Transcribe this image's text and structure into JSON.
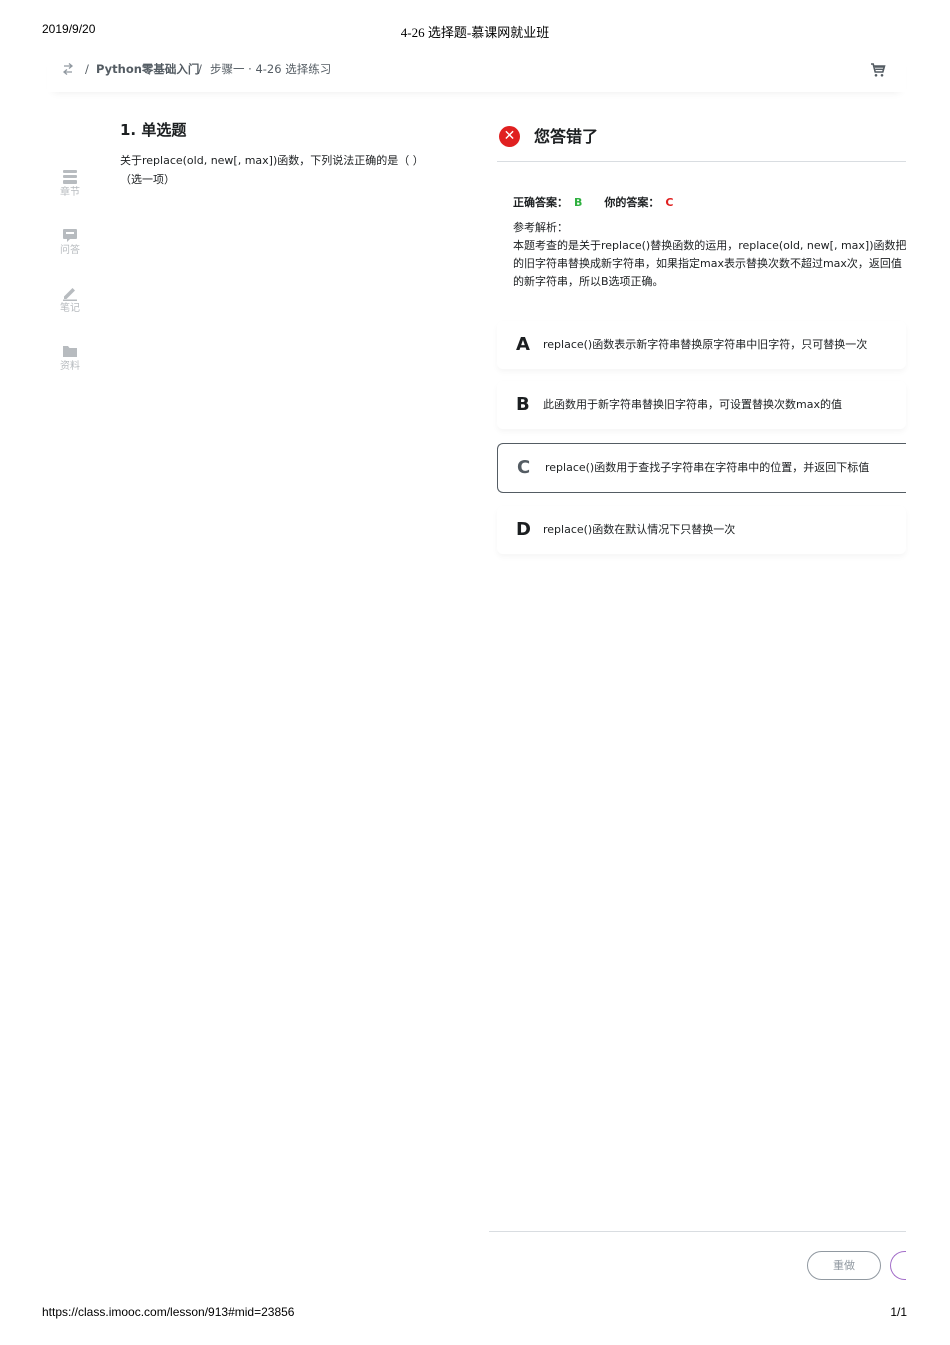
{
  "print_header": {
    "date": "2019/9/20",
    "title": "4-26 选择题-慕课网就业班"
  },
  "print_footer": {
    "url": "https://class.imooc.com/lesson/913#mid=23856",
    "pages": "1/1"
  },
  "breadcrumb": {
    "separator": "/",
    "course": "Python零基础入门",
    "current": "步骤一 · 4-26 选择练习"
  },
  "sidenav": [
    {
      "label": "章节",
      "icon": "chapter-icon"
    },
    {
      "label": "问答",
      "icon": "qa-icon"
    },
    {
      "label": "笔记",
      "icon": "note-pencil-icon"
    },
    {
      "label": "资料",
      "icon": "folder-icon"
    }
  ],
  "question": {
    "title": "1. 单选题",
    "text_line1": "关于replace(old, new[, max])函数，下列说法正确的是（ ）",
    "text_line2": "（选一项）"
  },
  "result": {
    "title": "您答错了",
    "correct_label": "正确答案：",
    "correct_value": "B",
    "your_label": "你的答案：",
    "your_value": "C",
    "analysis_label": "参考解析：",
    "analysis_line1": "本题考查的是关于replace()替换函数的运用，replace(old, new[, max])函数把字",
    "analysis_line2": "的旧字符串替换成新字符串，如果指定max表示替换次数不超过max次，返回值",
    "analysis_line3": "的新字符串，所以B选项正确。"
  },
  "options": [
    {
      "letter": "A",
      "text": "replace()函数表示新字符串替换原字符串中旧字符，只可替换一次"
    },
    {
      "letter": "B",
      "text": "此函数用于新字符串替换旧字符串，可设置替换次数max的值"
    },
    {
      "letter": "C",
      "text": "replace()函数用于查找子字符串在字符串中的位置，并返回下标值"
    },
    {
      "letter": "D",
      "text": "replace()函数在默认情况下只替换一次"
    }
  ],
  "selected_option": "C",
  "buttons": {
    "redo": "重做"
  },
  "colors": {
    "error": "#e02020",
    "correct": "#2eb03f",
    "muted": "#b7bbbf",
    "accent": "#a36ec9"
  }
}
